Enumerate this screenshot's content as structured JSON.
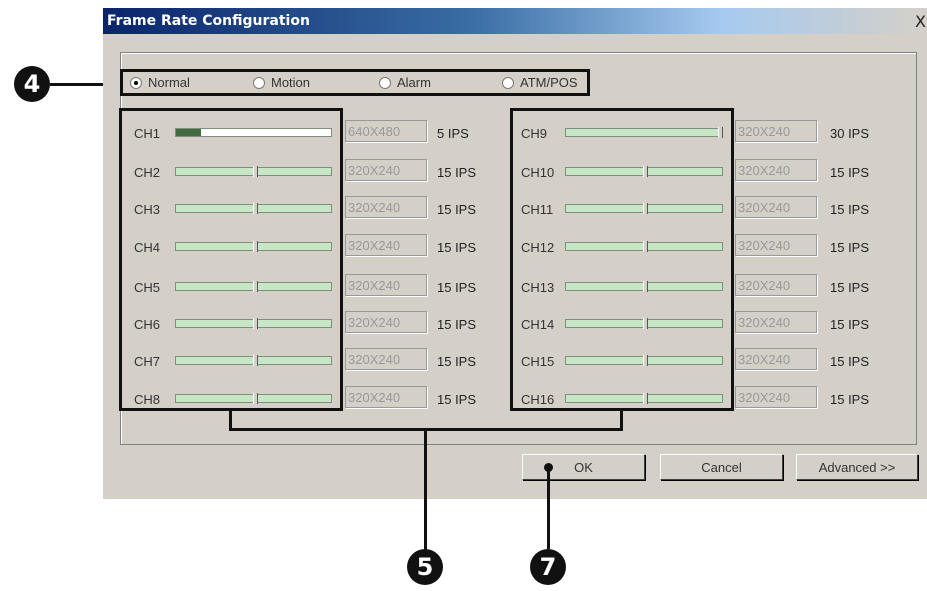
{
  "dialog": {
    "title": "Frame Rate Configuration",
    "close_label": "X"
  },
  "modes": [
    {
      "label": "Normal",
      "selected": true
    },
    {
      "label": "Motion",
      "selected": false
    },
    {
      "label": "Alarm",
      "selected": false
    },
    {
      "label": "ATM/POS",
      "selected": false
    }
  ],
  "channels_left": [
    {
      "name": "CH1",
      "slider": 0.16,
      "resolution": "640X480",
      "ips": "5 IPS"
    },
    {
      "name": "CH2",
      "slider": 0.5,
      "resolution": "320X240",
      "ips": "15 IPS"
    },
    {
      "name": "CH3",
      "slider": 0.5,
      "resolution": "320X240",
      "ips": "15 IPS"
    },
    {
      "name": "CH4",
      "slider": 0.5,
      "resolution": "320X240",
      "ips": "15 IPS"
    },
    {
      "name": "CH5",
      "slider": 0.5,
      "resolution": "320X240",
      "ips": "15 IPS"
    },
    {
      "name": "CH6",
      "slider": 0.5,
      "resolution": "320X240",
      "ips": "15 IPS"
    },
    {
      "name": "CH7",
      "slider": 0.5,
      "resolution": "320X240",
      "ips": "15 IPS"
    },
    {
      "name": "CH8",
      "slider": 0.5,
      "resolution": "320X240",
      "ips": "15 IPS"
    }
  ],
  "channels_right": [
    {
      "name": "CH9",
      "slider": 1.0,
      "resolution": "320X240",
      "ips": "30 IPS"
    },
    {
      "name": "CH10",
      "slider": 0.5,
      "resolution": "320X240",
      "ips": "15 IPS"
    },
    {
      "name": "CH11",
      "slider": 0.5,
      "resolution": "320X240",
      "ips": "15 IPS"
    },
    {
      "name": "CH12",
      "slider": 0.5,
      "resolution": "320X240",
      "ips": "15 IPS"
    },
    {
      "name": "CH13",
      "slider": 0.5,
      "resolution": "320X240",
      "ips": "15 IPS"
    },
    {
      "name": "CH14",
      "slider": 0.5,
      "resolution": "320X240",
      "ips": "15 IPS"
    },
    {
      "name": "CH15",
      "slider": 0.5,
      "resolution": "320X240",
      "ips": "15 IPS"
    },
    {
      "name": "CH16",
      "slider": 0.5,
      "resolution": "320X240",
      "ips": "15 IPS"
    }
  ],
  "buttons": {
    "ok": "OK",
    "cancel": "Cancel",
    "advanced": "Advanced >>"
  },
  "callouts": {
    "mode": "4",
    "channels": "5",
    "ok": "7"
  }
}
